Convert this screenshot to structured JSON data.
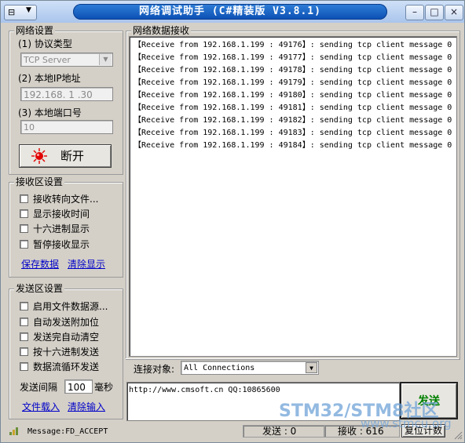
{
  "window": {
    "title": "网络调试助手 (C#精装版 V3.8.1)",
    "sys_icon": "⊟",
    "sys_dropdown": "▼",
    "btn_min": "–",
    "btn_max": "□",
    "btn_close": "×"
  },
  "network": {
    "group_label": "网络设置",
    "protocol_label": "(1) 协议类型",
    "protocol_value": "TCP Server",
    "ip_label": "(2) 本地IP地址",
    "ip_value": "192.168. 1 .30",
    "port_label": "(3) 本地端口号",
    "port_value": "10",
    "disconnect_label": "断开"
  },
  "receive_settings": {
    "group_label": "接收区设置",
    "options": [
      "接收转向文件...",
      "显示接收时间",
      "十六进制显示",
      "暂停接收显示"
    ],
    "save_link": "保存数据",
    "clear_link": "清除显示"
  },
  "send_settings": {
    "group_label": "发送区设置",
    "options": [
      "启用文件数据源...",
      "自动发送附加位",
      "发送完自动清空",
      "按十六进制发送",
      "数据流循环发送"
    ],
    "interval_label": "发送间隔",
    "interval_value": "100",
    "interval_unit": "毫秒",
    "load_file_link": "文件载入",
    "clear_input_link": "清除输入"
  },
  "receive_area": {
    "label": "网络数据接收",
    "lines": [
      "【Receive from 192.168.1.199 : 49176】: sending tcp client message 0",
      "【Receive from 192.168.1.199 : 49177】: sending tcp client message 0",
      "【Receive from 192.168.1.199 : 49178】: sending tcp client message 0",
      "【Receive from 192.168.1.199 : 49179】: sending tcp client message 0",
      "【Receive from 192.168.1.199 : 49180】: sending tcp client message 0",
      "【Receive from 192.168.1.199 : 49181】: sending tcp client message 0",
      "【Receive from 192.168.1.199 : 49182】: sending tcp client message 0",
      "【Receive from 192.168.1.199 : 49183】: sending tcp client message 0",
      "【Receive from 192.168.1.199 : 49184】: sending tcp client message 0"
    ]
  },
  "target": {
    "label": "连接对象:",
    "value": "All Connections"
  },
  "send_area": {
    "text": "http://www.cmsoft.cn QQ:10865600",
    "send_button": "发送"
  },
  "status": {
    "message": "Message:FD_ACCEPT",
    "sent_label": "发送 : 0",
    "recv_label": "接收 : 616",
    "reset_button": "复位计数"
  },
  "watermark": {
    "brand": "STM32/STM8社区",
    "url": "www.stmcu.org"
  },
  "colors": {
    "title_bar": "#1a5fc4",
    "window_bg": "#d4d0c8",
    "link": "#0000c8",
    "send_green": "#008000",
    "indicator_red": "#e00000"
  }
}
